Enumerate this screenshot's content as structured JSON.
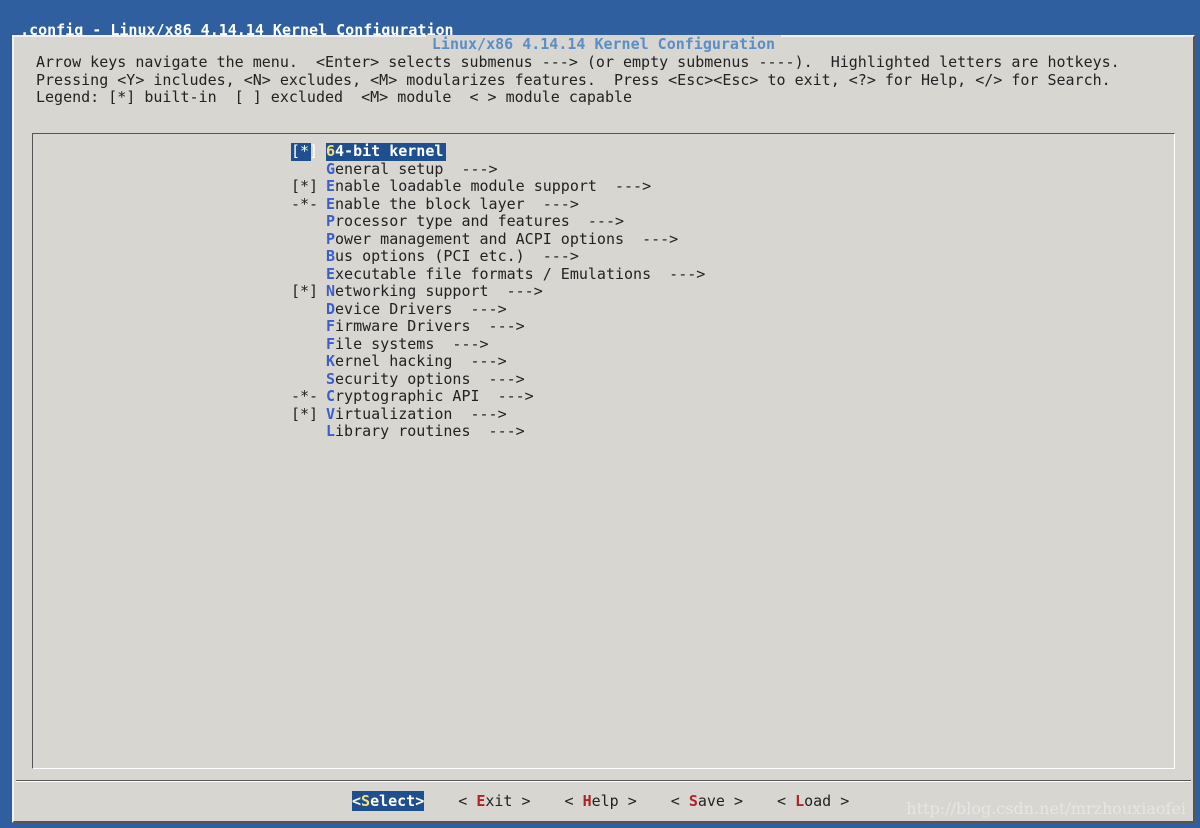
{
  "window": {
    "title": ".config - Linux/x86 4.14.14 Kernel Configuration"
  },
  "dialog": {
    "title": "Linux/x86 4.14.14 Kernel Configuration",
    "help_text": "Arrow keys navigate the menu.  <Enter> selects submenus ---> (or empty submenus ----).  Highlighted letters are hotkeys.  Pressing <Y> includes, <N> excludes, <M> modularizes features.  Press <Esc><Esc> to exit, <?> for Help, </> for Search.  Legend: [*] built-in  [ ] excluded  <M> module  < > module capable"
  },
  "menu": {
    "items": [
      {
        "marker": "[*]",
        "hotkey": "6",
        "rest": "4-bit kernel",
        "suffix": ""
      },
      {
        "marker": "",
        "hotkey": "G",
        "rest": "eneral setup",
        "suffix": "  --->"
      },
      {
        "marker": "[*]",
        "hotkey": "E",
        "rest": "nable loadable module support",
        "suffix": "  --->"
      },
      {
        "marker": "-*-",
        "hotkey": "E",
        "rest": "nable the block layer",
        "suffix": "  --->"
      },
      {
        "marker": "",
        "hotkey": "P",
        "rest": "rocessor type and features",
        "suffix": "  --->"
      },
      {
        "marker": "",
        "hotkey": "P",
        "rest": "ower management and ACPI options",
        "suffix": "  --->"
      },
      {
        "marker": "",
        "hotkey": "B",
        "rest": "us options (PCI etc.)",
        "suffix": "  --->"
      },
      {
        "marker": "",
        "hotkey": "E",
        "rest": "xecutable file formats / Emulations",
        "suffix": "  --->"
      },
      {
        "marker": "[*]",
        "hotkey": "N",
        "rest": "etworking support",
        "suffix": "  --->"
      },
      {
        "marker": "",
        "hotkey": "D",
        "rest": "evice Drivers",
        "suffix": "  --->"
      },
      {
        "marker": "",
        "hotkey": "F",
        "rest": "irmware Drivers",
        "suffix": "  --->"
      },
      {
        "marker": "",
        "hotkey": "F",
        "rest": "ile systems",
        "suffix": "  --->"
      },
      {
        "marker": "",
        "hotkey": "K",
        "rest": "ernel hacking",
        "suffix": "  --->"
      },
      {
        "marker": "",
        "hotkey": "S",
        "rest": "ecurity options",
        "suffix": "  --->"
      },
      {
        "marker": "-*-",
        "hotkey": "C",
        "rest": "ryptographic API",
        "suffix": "  --->"
      },
      {
        "marker": "[*]",
        "hotkey": "V",
        "rest": "irtualization",
        "suffix": "  --->"
      },
      {
        "marker": "",
        "hotkey": "L",
        "rest": "ibrary routines",
        "suffix": "  --->"
      }
    ],
    "selected_index": 0
  },
  "buttons": [
    {
      "pre": "<",
      "hotkey": "S",
      "rest": "elect",
      "post": ">"
    },
    {
      "pre": "< ",
      "hotkey": "E",
      "rest": "xit",
      "post": " >"
    },
    {
      "pre": "< ",
      "hotkey": "H",
      "rest": "elp",
      "post": " >"
    },
    {
      "pre": "< ",
      "hotkey": "S",
      "rest": "ave",
      "post": " >"
    },
    {
      "pre": "< ",
      "hotkey": "L",
      "rest": "oad",
      "post": " >"
    }
  ],
  "watermark": "http://blog.csdn.net/mrzhouxiaofei"
}
